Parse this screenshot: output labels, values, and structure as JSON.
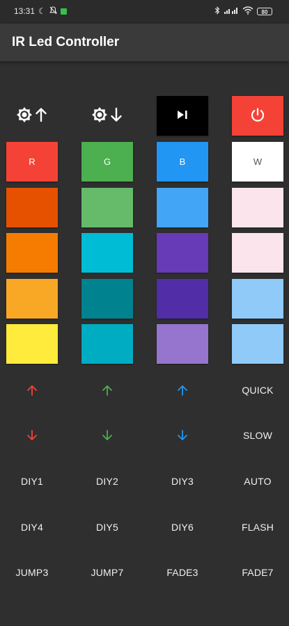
{
  "status_bar": {
    "time": "13:31",
    "battery": "80"
  },
  "app_bar": {
    "title": "IR Led Controller"
  },
  "controls": {
    "brightness_up_icon": "brightness-up-icon",
    "brightness_down_icon": "brightness-down-icon",
    "play_pause_icon": "play-pause-icon",
    "power_icon": "power-icon",
    "power_color": "#f44336",
    "play_pause_color": "#000000"
  },
  "color_rows": [
    [
      {
        "label": "R",
        "color": "#f44336"
      },
      {
        "label": "G",
        "color": "#4caf50"
      },
      {
        "label": "B",
        "color": "#2196f3"
      },
      {
        "label": "W",
        "color": "#ffffff"
      }
    ],
    [
      {
        "label": "",
        "color": "#e65100"
      },
      {
        "label": "",
        "color": "#66bb6a"
      },
      {
        "label": "",
        "color": "#42a5f5"
      },
      {
        "label": "",
        "color": "#fce4ec"
      }
    ],
    [
      {
        "label": "",
        "color": "#f57c00"
      },
      {
        "label": "",
        "color": "#00bcd4"
      },
      {
        "label": "",
        "color": "#673ab7"
      },
      {
        "label": "",
        "color": "#fce4ec"
      }
    ],
    [
      {
        "label": "",
        "color": "#f9a825"
      },
      {
        "label": "",
        "color": "#00838f"
      },
      {
        "label": "",
        "color": "#512da8"
      },
      {
        "label": "",
        "color": "#90caf9"
      }
    ],
    [
      {
        "label": "",
        "color": "#ffeb3b"
      },
      {
        "label": "",
        "color": "#00acc1"
      },
      {
        "label": "",
        "color": "#9575cd"
      },
      {
        "label": "",
        "color": "#90caf9"
      }
    ]
  ],
  "arrow_colors": {
    "red": "#f44336",
    "green": "#4caf50",
    "blue": "#2196f3"
  },
  "mode_buttons": {
    "quick": "QUICK",
    "slow": "SLOW",
    "diy1": "DIY1",
    "diy2": "DIY2",
    "diy3": "DIY3",
    "auto": "AUTO",
    "diy4": "DIY4",
    "diy5": "DIY5",
    "diy6": "DIY6",
    "flash": "FLASH",
    "jump3": "JUMP3",
    "jump7": "JUMP7",
    "fade3": "FADE3",
    "fade7": "FADE7"
  }
}
